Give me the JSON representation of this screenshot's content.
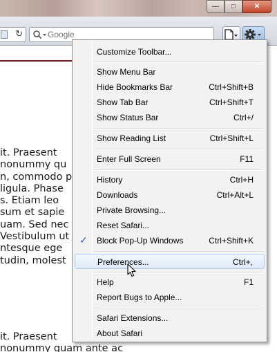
{
  "window": {
    "minimize_glyph": "—",
    "maximize_glyph": "□",
    "close_glyph": "✕"
  },
  "toolbar": {
    "reload_glyph": "↻",
    "search": {
      "placeholder": "Google",
      "icon": "magnifier-icon"
    },
    "page_menu_icon": "page-icon",
    "settings_menu_icon": "gear-icon"
  },
  "content": {
    "para1_lines": [
      "it. Praesent",
      " nonummy qu",
      "n, commodo p",
      "ligula. Phase",
      "s. Etiam leo",
      "sum et sapie",
      "uam. Sed nec",
      "Vestibulum ut",
      "ntesque ege",
      "tudin, molest"
    ],
    "para2_lines": [
      "it. Praesent",
      " nonummy quam ante ac"
    ]
  },
  "menu": {
    "customize_toolbar": "Customize Toolbar...",
    "show_menu_bar": "Show Menu Bar",
    "hide_bookmarks_bar": {
      "label": "Hide Bookmarks Bar",
      "shortcut": "Ctrl+Shift+B"
    },
    "show_tab_bar": {
      "label": "Show Tab Bar",
      "shortcut": "Ctrl+Shift+T"
    },
    "show_status_bar": {
      "label": "Show Status Bar",
      "shortcut": "Ctrl+/"
    },
    "show_reading_list": {
      "label": "Show Reading List",
      "shortcut": "Ctrl+Shift+L"
    },
    "enter_full_screen": {
      "label": "Enter Full Screen",
      "shortcut": "F11"
    },
    "history": {
      "label": "History",
      "shortcut": "Ctrl+H"
    },
    "downloads": {
      "label": "Downloads",
      "shortcut": "Ctrl+Alt+L"
    },
    "private_browsing": "Private Browsing...",
    "reset_safari": "Reset Safari...",
    "block_popups": {
      "label": "Block Pop-Up Windows",
      "shortcut": "Ctrl+Shift+K",
      "checked": true,
      "check_glyph": "✓"
    },
    "preferences": {
      "label": "Preferences...",
      "shortcut": "Ctrl+,",
      "highlighted": true
    },
    "help": {
      "label": "Help",
      "shortcut": "F1"
    },
    "report_bugs": "Report Bugs to Apple...",
    "safari_extensions": "Safari Extensions...",
    "about_safari": "About Safari"
  }
}
